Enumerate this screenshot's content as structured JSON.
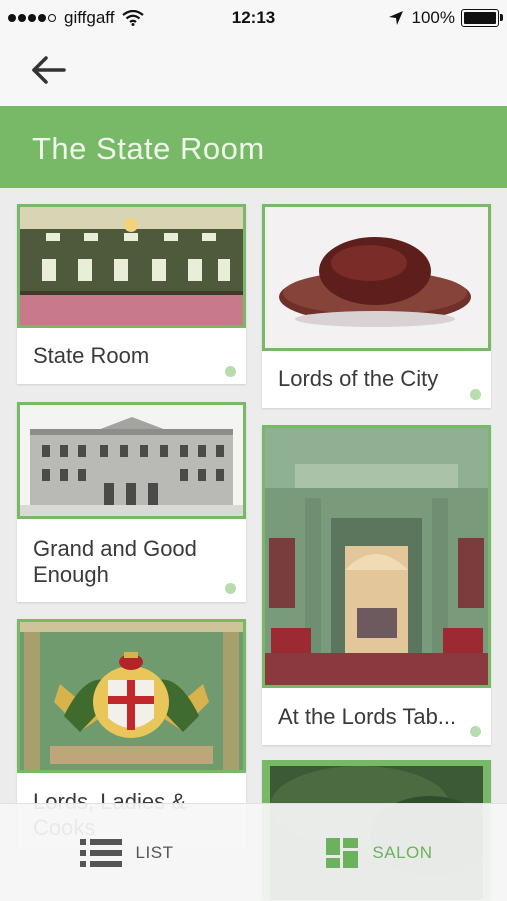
{
  "status_bar": {
    "carrier": "giffgaff",
    "time": "12:13",
    "battery": "100%",
    "signal_bars": 4,
    "signal_bars_total": 5
  },
  "nav": {
    "back_icon": "arrow-left-icon"
  },
  "header": {
    "title": "The State Room"
  },
  "cards": [
    {
      "label": "State Room",
      "image": "state-room-interior"
    },
    {
      "label": "Lords of the City",
      "image": "velvet-hat"
    },
    {
      "label": "Grand and Good Enough",
      "image": "building-engraving"
    },
    {
      "label": "At the Lords Tab...",
      "image": "green-hall-doorway"
    },
    {
      "label": "Lords, Ladies & Cooks",
      "image": "coat-of-arms"
    },
    {
      "label": "",
      "image": "green-painting"
    }
  ],
  "tabs": [
    {
      "label": "LIST",
      "icon": "list-icon"
    },
    {
      "label": "SALON",
      "icon": "grid-icon",
      "active": true
    }
  ],
  "colors": {
    "accent": "#78b968",
    "accent_text": "#6db05e",
    "status_dot": "#b7dcb0"
  }
}
